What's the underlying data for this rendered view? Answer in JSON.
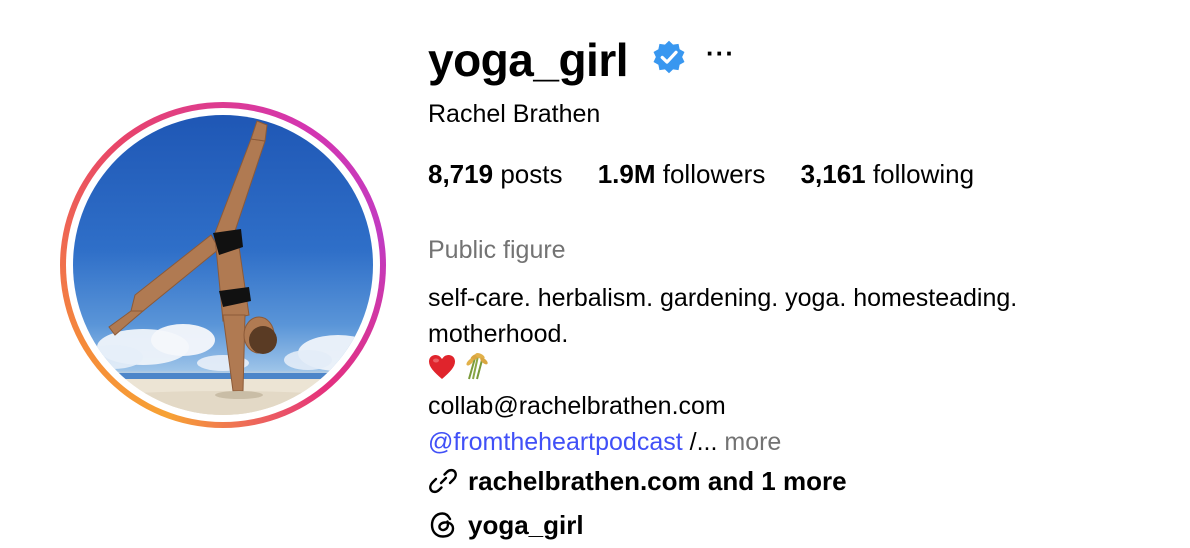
{
  "profile": {
    "username": "yoga_girl",
    "full_name": "Rachel Brathen",
    "more_options": "···",
    "verified": true,
    "verified_icon": "verified-badge-icon",
    "accent_color": "#3897f0"
  },
  "stats": {
    "posts_count": "8,719",
    "posts_label": "posts",
    "followers_count": "1.9M",
    "followers_label": "followers",
    "following_count": "3,161",
    "following_label": "following"
  },
  "bio": {
    "category": "Public figure",
    "line1": "self-care. herbalism. gardening. yoga. homesteading.",
    "line2": "motherhood.",
    "emojis": [
      "heart-emoji",
      "rice-sheaf-emoji"
    ],
    "email": "collab@rachelbrathen.com",
    "mention": "@fromtheheartpodcast",
    "truncation": " /... ",
    "more_label": "more",
    "mention_color": "#4150f7"
  },
  "links": {
    "website_text": "rachelbrathen.com and 1 more",
    "website_icon": "link-icon",
    "threads_text": "yoga_girl",
    "threads_icon": "threads-icon"
  }
}
